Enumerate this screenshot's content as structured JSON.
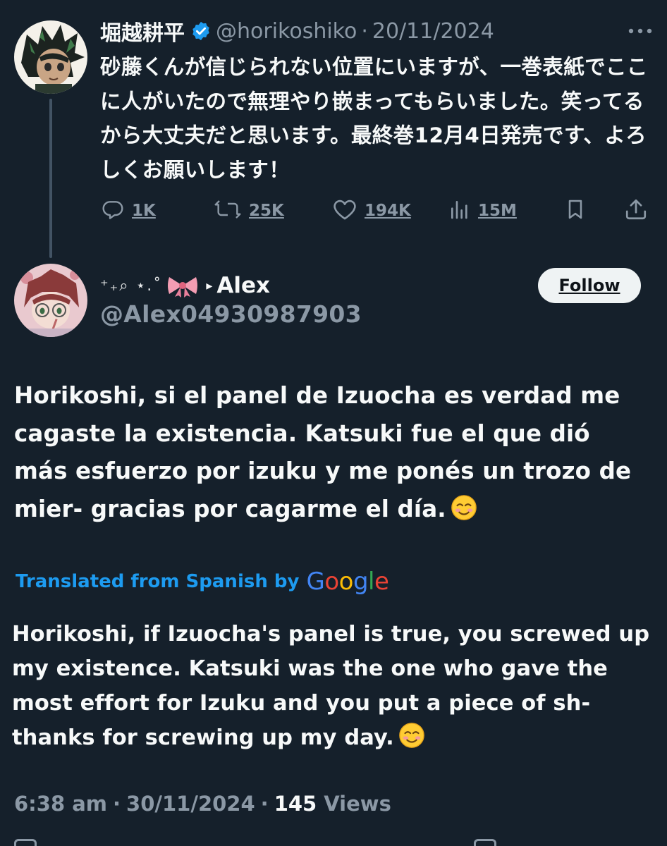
{
  "colors": {
    "background": "#15202b",
    "text_primary": "#f7f9f9",
    "text_secondary": "#8b98a5",
    "accent_blue": "#1d9bf0",
    "follow_button_bg": "#eff3f4"
  },
  "parent_tweet": {
    "display_name": "堀越耕平",
    "verified_icon": "verified-badge-icon",
    "handle": "@horikoshiko",
    "separator": "·",
    "date": "20/11/2024",
    "text": "砂藤くんが信じられない位置にいますが、一巻表紙でここに人がいたので無理やり嵌まってもらいました。笑ってるから大丈夫だと思います。最終巻12月4日発売です、よろしくお願いします！",
    "actions": {
      "replies": "1K",
      "retweets": "25K",
      "likes": "194K",
      "views": "15M"
    }
  },
  "reply_tweet": {
    "name_decoration": "⁺₊⌕ ⋆.˚",
    "name_emoji": "bow-emoji-icon",
    "name_prefix": "▸",
    "display_name": "Alex",
    "handle": "@Alex04930987903",
    "follow_label": "Follow",
    "text": "Horikoshi, si el panel de Izuocha es verdad me cagaste la existencia. Katsuki fue el que dió más esfuerzo por izuku y me ponés un trozo de mier- gracias por cagarme el día.",
    "translated_label": "Translated from Spanish by",
    "google_letters": [
      "G",
      "o",
      "o",
      "g",
      "l",
      "e"
    ],
    "translation": "Horikoshi, if Izuocha's panel is true, you screwed up my existence. Katsuki was the one who gave the most effort for Izuku and you put a piece of sh- thanks for screwing up my day.",
    "emoji_icon": "smiling-face-emoji-icon",
    "time": "6:38 am",
    "separator": "·",
    "date": "30/11/2024",
    "views_count": "145",
    "views_label": "Views"
  }
}
